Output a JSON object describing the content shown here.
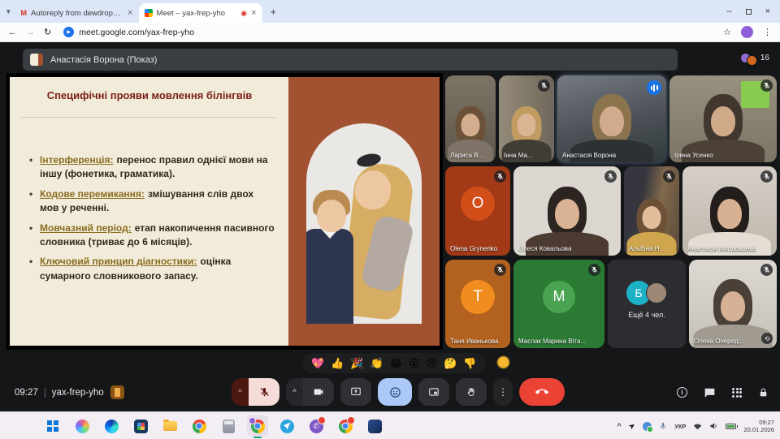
{
  "icons": {
    "dropdown": "▾",
    "close": "×",
    "plus": "+",
    "minimize": "–",
    "record": "◉",
    "back": "←",
    "forward": "→",
    "reload": "↻",
    "star": "☆",
    "more": "⋮",
    "chevron_up": "^",
    "flip": "⟲",
    "info": "i"
  },
  "browser": {
    "tabs": [
      {
        "title": "Autoreply from dewdrop@uk..."
      },
      {
        "title": "Meet – yax-frep-yho"
      }
    ],
    "url": "meet.google.com/yax-frep-yho"
  },
  "meet": {
    "presenter_banner": "Анастасія Ворона (Показ)",
    "participant_count": "16",
    "slide": {
      "title": "Специфічні прояви мовлення білінгвів",
      "bullets": [
        {
          "term": "Інтерференція:",
          "text": "перенос правил однієї мови на іншу (фонетика, граматика)."
        },
        {
          "term": "Кодове перемикання:",
          "text": "змішування слів двох мов у реченні."
        },
        {
          "term": "Мовчазний період:",
          "text": "етап накопичення пасивного словника (триває до 6 місяців)."
        },
        {
          "term": "Ключовий принцип діагностики:",
          "text": "оцінка сумарного словникового запасу."
        }
      ]
    },
    "rows": [
      [
        {
          "name": "Лариса В...",
          "type": "video",
          "w": 62,
          "bg": "linear-gradient(180deg,#7d7466,#5f5749)",
          "hair": "#6a5138",
          "face": "#d4ad8e",
          "shirt": "#7e7366",
          "muted": false
        },
        {
          "name": "Інна Ма...",
          "type": "video",
          "w": 68,
          "bg": "linear-gradient(90deg,#958b7a,#6f675a)",
          "hair": "#c09c61",
          "face": "#dcb694",
          "shirt": "#403d35",
          "muted": true
        },
        {
          "name": "Анастасія Ворона",
          "type": "video",
          "w": 134,
          "bg": "linear-gradient(165deg,#757a81,#4c5157 55%,#303a3a)",
          "hair": "#8b734d",
          "face": "#d2ab8c",
          "shirt": "#2d3134",
          "audio": true,
          "speaking": true
        },
        {
          "name": "Ірина Усенко",
          "type": "video",
          "w": 132,
          "bg": "linear-gradient(180deg,#99917f,#7c7464)",
          "hair": "#41372e",
          "face": "#d0a988",
          "shirt": "#4c4136",
          "muted": true,
          "deco": "#86d24c"
        }
      ],
      [
        {
          "name": "Olena Grynenko",
          "type": "avatar",
          "w": 80,
          "bg": "#a23a18",
          "circle": "#d14e18",
          "letter": "O",
          "muted": true
        },
        {
          "name": "Олеся Ковальова",
          "type": "video",
          "w": 132,
          "bg": "#dbd6d0",
          "hair": "#2c2420",
          "face": "#d9b394",
          "shirt": "#4b3b31",
          "muted": true
        },
        {
          "name": "Альбіна Н...",
          "type": "video",
          "w": 68,
          "bg": "linear-gradient(100deg,#35363e 32%,#81694c 60%,#5b4b3c)",
          "hair": "#6d5137",
          "face": "#e2bd9c",
          "shirt": "#cfa64e",
          "muted": true
        },
        {
          "name": "Анастасія Мордовцева",
          "type": "video",
          "w": 116,
          "bg": "linear-gradient(180deg,#d6d0c8,#bdb6ac)",
          "hair": "#231e1c",
          "face": "#d8b192",
          "shirt": "#e3ddd3",
          "muted": true
        }
      ],
      [
        {
          "name": "Таня Иванькова",
          "type": "avatar",
          "w": 80,
          "bg": "#b2611e",
          "circle": "#f18c1f",
          "letter": "Т",
          "muted": true
        },
        {
          "name": "Маслак Марина Віта...",
          "type": "avatar",
          "w": 112,
          "bg": "#2b7a34",
          "circle": "#4aa350",
          "letter": "М",
          "muted": true
        },
        {
          "name": "Ещё 4 чел.",
          "type": "overflow",
          "w": 96,
          "bg": "#2b2d30",
          "circle": "#1db1c6",
          "letter": "Б"
        },
        {
          "name": "Олена Очеред...",
          "type": "video",
          "w": 108,
          "bg": "linear-gradient(180deg,#ddd8d1,#c6c1b8)",
          "hair": "#4a4038",
          "face": "#d6b195",
          "shirt": "#a09a90",
          "muted": true,
          "flip": true
        }
      ]
    ],
    "reactions": [
      "💖",
      "👍",
      "🎉",
      "👏",
      "😂",
      "😮",
      "😢",
      "🤔",
      "👎"
    ],
    "bottom": {
      "time": "09:27",
      "code": "yax-frep-yho"
    }
  },
  "taskbar": {
    "icons": [
      {
        "name": "start"
      },
      {
        "name": "copilot"
      },
      {
        "name": "edge"
      },
      {
        "name": "store"
      },
      {
        "name": "file-explorer"
      },
      {
        "name": "chrome"
      },
      {
        "name": "calculator"
      },
      {
        "name": "meet-app",
        "active": true
      },
      {
        "name": "telegram"
      },
      {
        "name": "viber",
        "badge": true
      },
      {
        "name": "chrome-profile",
        "badge": true
      },
      {
        "name": "mail-app"
      }
    ],
    "lang": "УКР",
    "time": "09:27",
    "date": "20.01.2026"
  }
}
